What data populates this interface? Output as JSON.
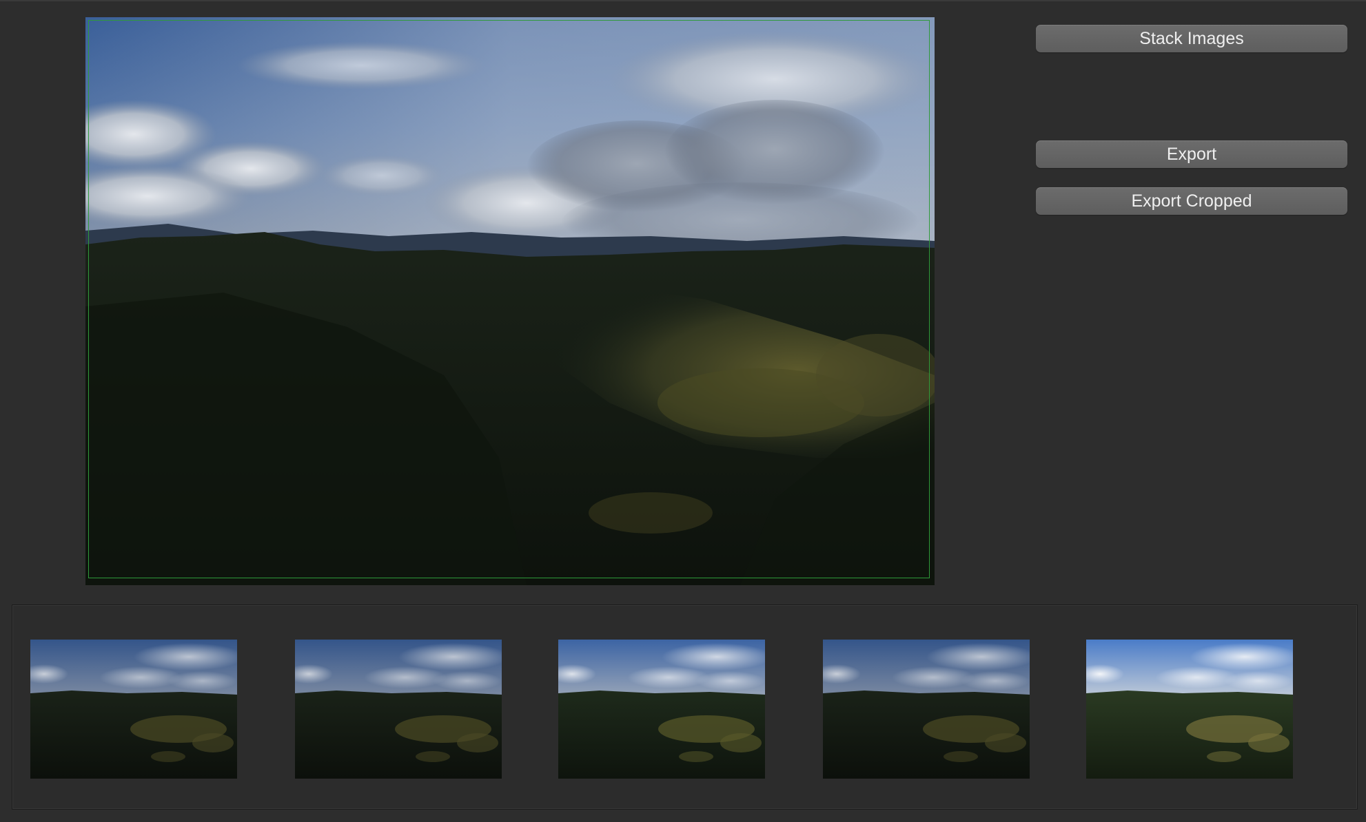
{
  "buttons": {
    "stack_label": "Stack Images",
    "export_label": "Export",
    "export_cropped_label": "Export Cropped"
  },
  "main_preview": {
    "content": "stacked-landscape-preview",
    "crop_outline_color": "#2f9a3a"
  },
  "thumbnails": [
    {
      "exposure": "dark"
    },
    {
      "exposure": "dark"
    },
    {
      "exposure": "medium"
    },
    {
      "exposure": "dark"
    },
    {
      "exposure": "bright"
    }
  ],
  "colors": {
    "window_bg": "#2d2d2d",
    "button_bg": "#656565",
    "button_text": "#efefef"
  }
}
